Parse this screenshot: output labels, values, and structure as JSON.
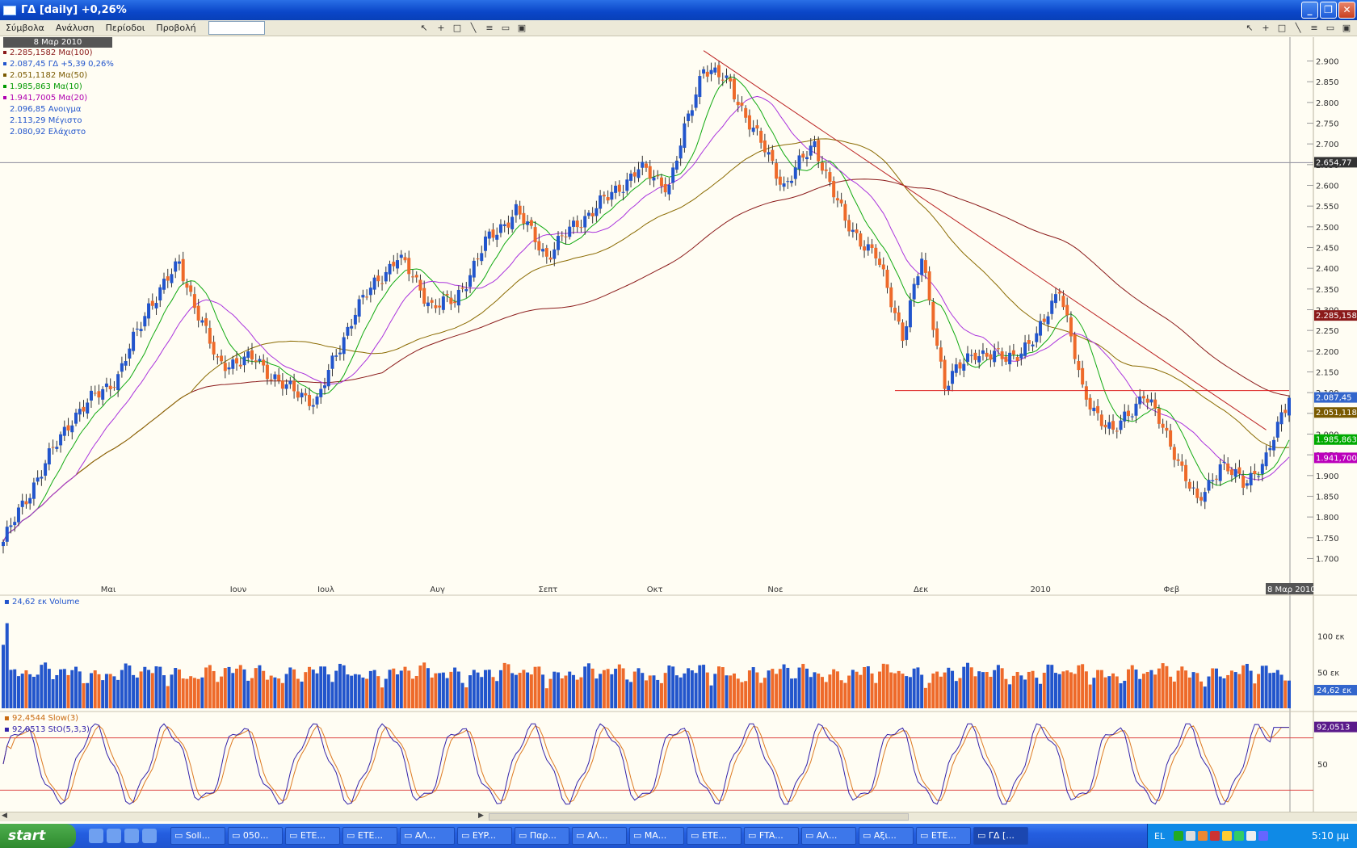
{
  "window": {
    "title": "ΓΔ [daily] +0,26%",
    "btn_min": "_",
    "btn_max": "❐",
    "btn_close": "✕"
  },
  "menu": {
    "items": [
      "Σύμβολα",
      "Ανάλυση",
      "Περίοδοι",
      "Προβολή"
    ]
  },
  "legend": {
    "date": "8 Μαρ 2010",
    "items": [
      {
        "text": "2.285,1582 Mα(100)",
        "color": "#8b1a1a"
      },
      {
        "text": "2.087,45 ΓΔ +5,39 0,26%",
        "color": "#2255cc"
      },
      {
        "text": "2.051,1182 Mα(50)",
        "color": "#7a5a00"
      },
      {
        "text": "1.985,863 Mα(10)",
        "color": "#009900"
      },
      {
        "text": "1.941,7005 Mα(20)",
        "color": "#b000b0"
      },
      {
        "text": "2.096,85 Ανοιγμα",
        "color": "#2255cc"
      },
      {
        "text": "2.113,29 Μέγιστο",
        "color": "#2255cc"
      },
      {
        "text": "2.080,92 Ελάχιστο",
        "color": "#2255cc"
      }
    ]
  },
  "chart_data": [
    {
      "type": "candlestick",
      "title": "ΓΔ [daily]",
      "x_labels": [
        "Μαι",
        "Ιουν",
        "Ιουλ",
        "Αυγ",
        "Σεπτ",
        "Οκτ",
        "Νοε",
        "Δεκ",
        "2010",
        "Φεβ",
        "8 Μαρ 2010"
      ],
      "y_ticks": [
        "2.900",
        "2.850",
        "2.800",
        "2.750",
        "2.700",
        "2.650",
        "2.600",
        "2.550",
        "2.500",
        "2.450",
        "2.400",
        "2.350",
        "2.300",
        "2.250",
        "2.200",
        "2.150",
        "2.100",
        "2.050",
        "2.000",
        "1.950",
        "1.900",
        "1.850",
        "1.800",
        "1.750",
        "1.700"
      ],
      "ylim": [
        1660,
        2940
      ],
      "close_anchors": [
        [
          0,
          1740
        ],
        [
          8,
          1880
        ],
        [
          18,
          2040
        ],
        [
          30,
          2140
        ],
        [
          38,
          2310
        ],
        [
          46,
          2410
        ],
        [
          56,
          2170
        ],
        [
          66,
          2180
        ],
        [
          74,
          2110
        ],
        [
          82,
          2080
        ],
        [
          92,
          2300
        ],
        [
          103,
          2430
        ],
        [
          112,
          2310
        ],
        [
          118,
          2320
        ],
        [
          126,
          2460
        ],
        [
          134,
          2540
        ],
        [
          142,
          2430
        ],
        [
          150,
          2510
        ],
        [
          158,
          2570
        ],
        [
          166,
          2640
        ],
        [
          174,
          2600
        ],
        [
          183,
          2890
        ],
        [
          190,
          2840
        ],
        [
          198,
          2700
        ],
        [
          204,
          2600
        ],
        [
          212,
          2700
        ],
        [
          220,
          2510
        ],
        [
          228,
          2430
        ],
        [
          235,
          2240
        ],
        [
          240,
          2420
        ],
        [
          246,
          2120
        ],
        [
          254,
          2200
        ],
        [
          262,
          2180
        ],
        [
          270,
          2230
        ],
        [
          276,
          2360
        ],
        [
          282,
          2100
        ],
        [
          290,
          2000
        ],
        [
          298,
          2100
        ],
        [
          306,
          1960
        ],
        [
          312,
          1830
        ],
        [
          318,
          1930
        ],
        [
          324,
          1880
        ],
        [
          330,
          1940
        ],
        [
          336,
          2087.45
        ]
      ],
      "markers": [
        {
          "label": "2.654,77",
          "value": 2654.77,
          "color": "#333333"
        },
        {
          "label": "2.285,158",
          "value": 2285.158,
          "color": "#8b1a1a"
        },
        {
          "label": "2.087,45",
          "value": 2087.45,
          "color": "#3366cc"
        },
        {
          "label": "2.051,118",
          "value": 2051.118,
          "color": "#7a5a00"
        },
        {
          "label": "1.985,863",
          "value": 1985.863,
          "color": "#00aa00"
        },
        {
          "label": "1.941,700",
          "value": 1941.7,
          "color": "#bb00bb"
        }
      ],
      "series": [
        {
          "name": "Mα(100)",
          "color": "#8b1a1a"
        },
        {
          "name": "Mα(50)",
          "color": "#8a6a00"
        },
        {
          "name": "Mα(10)",
          "color": "#11aa11"
        },
        {
          "name": "Mα(20)",
          "color": "#aa33dd"
        }
      ],
      "colors": {
        "up": "#2255cc",
        "down": "#ee6a2a"
      }
    },
    {
      "type": "bar",
      "title": "24,62 εκ Volume",
      "y_ticks": [
        "100 εκ",
        "50 εκ"
      ],
      "ylim": [
        0,
        140
      ],
      "last_label": "24,62 εκ"
    },
    {
      "type": "line",
      "series": [
        {
          "name": "92,4544 Slow(3)",
          "color": "#dd7a22"
        },
        {
          "name": "92,0513 StO(5,3,3)",
          "color": "#3322aa"
        }
      ],
      "y_ticks": [
        "50"
      ],
      "ylim": [
        0,
        100
      ],
      "levels": [
        80,
        20
      ],
      "last_label": "92,0513"
    }
  ],
  "scrollbar": {
    "left_arrow": "◀",
    "right_arrow": "▶"
  },
  "taskbar": {
    "start": "start",
    "tasks": [
      "Soli...",
      "050...",
      "ETE...",
      "ETE...",
      "ΑΛ...",
      "EYP...",
      "Παρ...",
      "ΑΛ...",
      "MA...",
      "ETE...",
      "FTA...",
      "ΑΛ...",
      "Αξι...",
      "ETE...",
      "ΓΔ [..."
    ],
    "lang": "EL",
    "clock": "5:10 μμ"
  }
}
